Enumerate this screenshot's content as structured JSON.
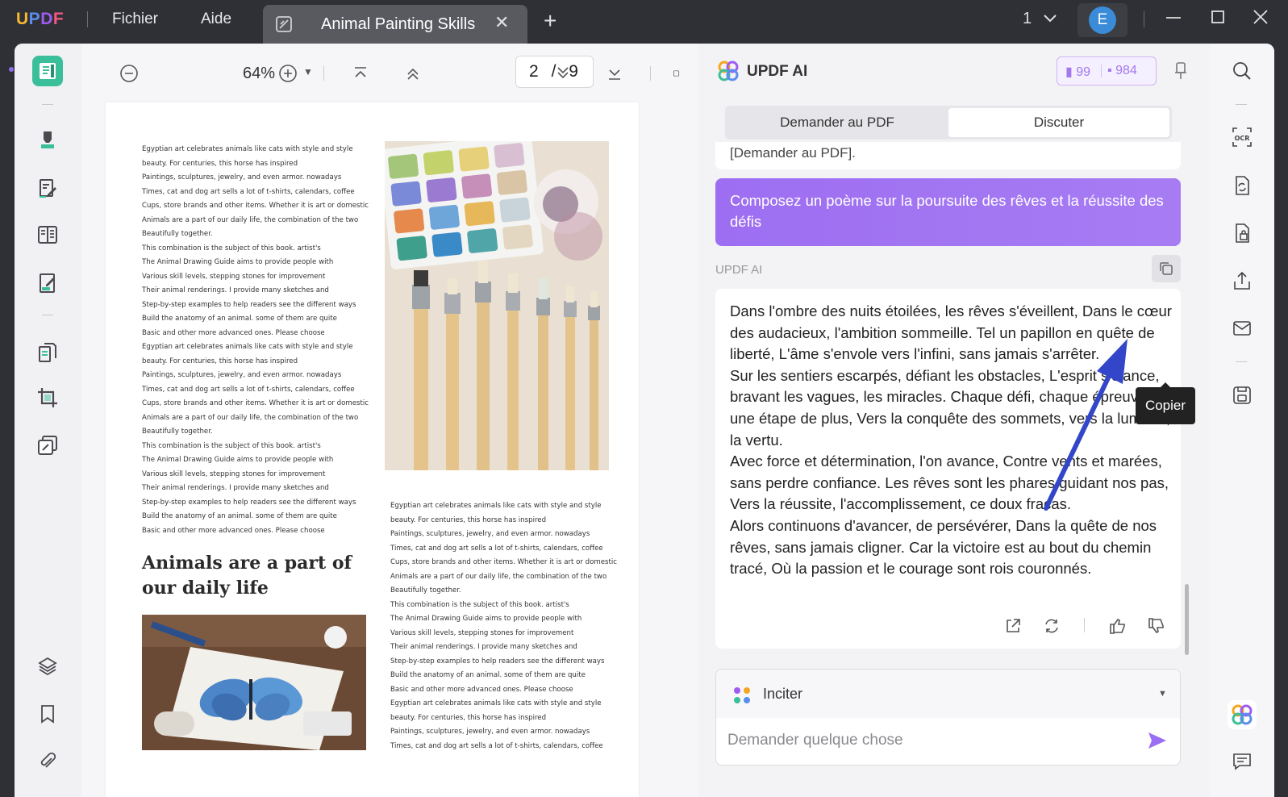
{
  "app": {
    "logo": "UPDF",
    "menu": [
      "Fichier",
      "Aide"
    ],
    "tab_title": "Animal Painting Skills",
    "page_selector": "1",
    "avatar_letter": "E",
    "accent": "#3bbf9b",
    "ai_accent": "#a26ff2"
  },
  "toolbar": {
    "zoom": "64%",
    "current_page": "2",
    "page_sep": "/",
    "total_pages": "9"
  },
  "document": {
    "left_column_lines": [
      "Egyptian art celebrates animals like cats with style and style",
      "beauty. For centuries, this horse has inspired",
      "Paintings, sculptures, jewelry, and even armor. nowadays",
      "Times, cat and dog art sells a lot of t-shirts, calendars, coffee",
      "Cups, store brands and other items. Whether it is art or domestic",
      "Animals are a part of our daily life, the combination of the two",
      "Beautifully together.",
      "This combination is the subject of this book. artist's",
      "The Animal Drawing Guide aims to provide people with",
      "Various skill levels, stepping stones for improvement",
      "Their animal renderings. I provide many sketches and",
      "Step-by-step examples to help readers see the different ways",
      "Build the anatomy of an animal. some of them are quite",
      "Basic and other more advanced ones. Please choose",
      "Egyptian art celebrates animals like cats with style and style",
      "beauty. For centuries, this horse has inspired",
      "Paintings, sculptures, jewelry, and even armor. nowadays",
      "Times, cat and dog art sells a lot of t-shirts, calendars, coffee",
      "Cups, store brands and other items. Whether it is art or domestic",
      "Animals are a part of our daily life, the combination of the two",
      "Beautifully together.",
      "This combination is the subject of this book. artist's",
      "The Animal Drawing Guide aims to provide people with",
      "Various skill levels, stepping stones for improvement",
      "Their animal renderings. I provide many sketches and",
      "Step-by-step examples to help readers see the different ways",
      "Build the anatomy of an animal. some of them are quite",
      "Basic and other more advanced ones. Please choose"
    ],
    "heading": "Animals are a part of our daily life",
    "right_column_lines": [
      "Egyptian art celebrates animals like cats with style and style",
      "beauty. For centuries, this horse has inspired",
      "Paintings, sculptures, jewelry, and even armor. nowadays",
      "Times, cat and dog art sells a lot of t-shirts, calendars, coffee",
      "Cups, store brands and other items. Whether it is art or domestic",
      "Animals are a part of our daily life, the combination of the two",
      "Beautifully together.",
      "This combination is the subject of this book. artist's",
      "The Animal Drawing Guide aims to provide people with",
      "Various skill levels, stepping stones for improvement",
      "Their animal renderings. I provide many sketches and",
      "Step-by-step examples to help readers see the different ways",
      "Build the anatomy of an animal. some of them are quite",
      "Basic and other more advanced ones. Please choose",
      "Egyptian art celebrates animals like cats with style and style",
      "beauty. For centuries, this horse has inspired",
      "Paintings, sculptures, jewelry, and even armor. nowadays",
      "Times, cat and dog art sells a lot of t-shirts, calendars, coffee"
    ]
  },
  "ai": {
    "title": "UPDF AI",
    "credits_doc": "99",
    "credits_chat": "984",
    "tabs": [
      "Demander au PDF",
      "Discuter"
    ],
    "previous_snippet": "[Demander au PDF].",
    "user_message": "Composez un poème sur la poursuite des rêves et la réussite des défis",
    "response_label": "UPDF AI",
    "tooltip": "Copier",
    "response_paragraphs": [
      "Dans l'ombre des nuits étoilées, les rêves s'éveillent, Dans le cœur des audacieux, l'ambition sommeille. Tel un papillon en quête de liberté, L'âme s'envole vers l'infini, sans jamais s'arrêter.",
      "Sur les sentiers escarpés, défiant les obstacles, L'esprit s'élance, bravant les vagues, les miracles. Chaque défi, chaque épreuve, une étape de plus, Vers la conquête des sommets, vers la lumière, la vertu.",
      "Avec force et détermination, l'on avance, Contre vents et marées, sans perdre confiance. Les rêves sont les phares guidant nos pas, Vers la réussite, l'accomplissement, ce doux fracas.",
      "Alors continuons d'avancer, de persévérer, Dans la quête de nos rêves, sans jamais cligner. Car la victoire est au bout du chemin tracé, Où la passion et le courage sont rois couronnés."
    ],
    "prompt_label": "Inciter",
    "input_placeholder": "Demander quelque chose"
  }
}
